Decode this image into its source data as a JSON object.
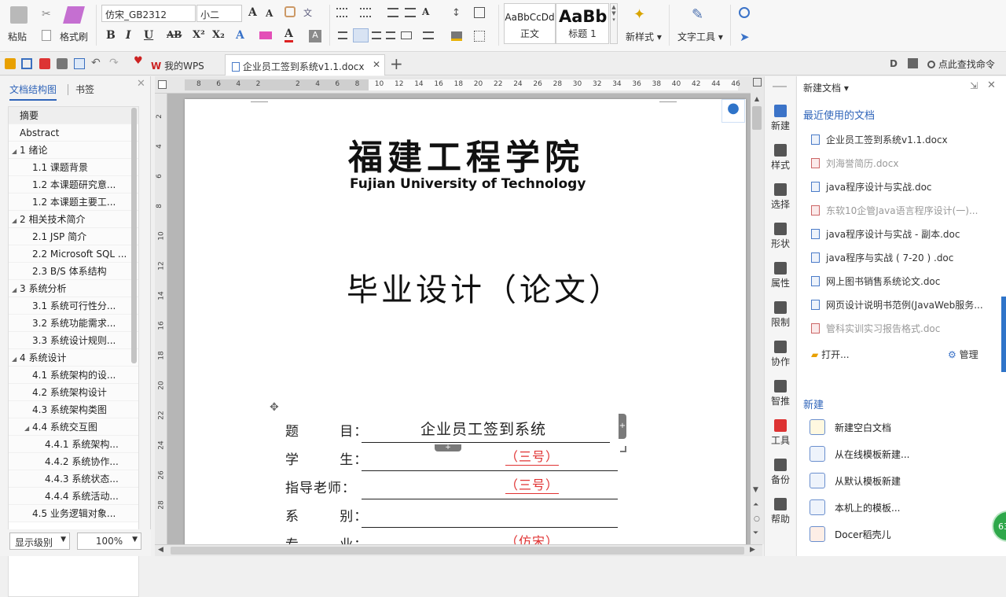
{
  "ribbon": {
    "paste": "粘贴",
    "format_painter": "格式刷",
    "font_name": "仿宋_GB2312",
    "font_size": "小二",
    "style_normal_preview": "AaBbCcDd",
    "style_normal": "正文",
    "style_h1_preview": "AaBb",
    "style_h1": "标题 1",
    "new_style": "新样式",
    "text_tools": "文字工具"
  },
  "tabs": {
    "wps": "我的WPS",
    "doc": "企业员工签到系统v1.1.docx",
    "search": "点此查找命令"
  },
  "left_panel": {
    "tab_outline": "文档结构图",
    "tab_bookmark": "书签",
    "items": [
      {
        "label": "摘要",
        "level": 1,
        "tri": ""
      },
      {
        "label": "Abstract",
        "level": 1,
        "tri": ""
      },
      {
        "label": "1  绪论",
        "level": 1,
        "tri": "◢"
      },
      {
        "label": "1.1  课题背景",
        "level": 2,
        "tri": ""
      },
      {
        "label": "1.2  本课题研究意...",
        "level": 2,
        "tri": ""
      },
      {
        "label": "1.2  本课题主要工...",
        "level": 2,
        "tri": ""
      },
      {
        "label": "2  相关技术简介",
        "level": 1,
        "tri": "◢"
      },
      {
        "label": "2.1 JSP 简介",
        "level": 2,
        "tri": ""
      },
      {
        "label": "2.2 Microsoft SQL ...",
        "level": 2,
        "tri": ""
      },
      {
        "label": "2.3 B/S 体系结构",
        "level": 2,
        "tri": ""
      },
      {
        "label": "3  系统分析",
        "level": 1,
        "tri": "◢"
      },
      {
        "label": "3.1  系统可行性分...",
        "level": 2,
        "tri": ""
      },
      {
        "label": "3.2  系统功能需求...",
        "level": 2,
        "tri": ""
      },
      {
        "label": "3.3  系统设计规则...",
        "level": 2,
        "tri": ""
      },
      {
        "label": "4  系统设计",
        "level": 1,
        "tri": "◢"
      },
      {
        "label": "4.1  系统架构的设...",
        "level": 2,
        "tri": ""
      },
      {
        "label": "4.2  系统架构设计",
        "level": 2,
        "tri": ""
      },
      {
        "label": "4.3  系统架构类图",
        "level": 2,
        "tri": ""
      },
      {
        "label": "4.4  系统交互图",
        "level": 2,
        "tri": "◢"
      },
      {
        "label": "4.4.1  系统架构...",
        "level": 3,
        "tri": ""
      },
      {
        "label": "4.4.2  系统协作...",
        "level": 3,
        "tri": ""
      },
      {
        "label": "4.4.3  系统状态...",
        "level": 3,
        "tri": ""
      },
      {
        "label": "4.4.4  系统活动...",
        "level": 3,
        "tri": ""
      },
      {
        "label": "4.5  业务逻辑对象...",
        "level": 2,
        "tri": ""
      }
    ],
    "show_level": "显示级别",
    "zoom": "100%"
  },
  "ruler": {
    "h": [
      "8",
      "6",
      "4",
      "2",
      "",
      "2",
      "4",
      "6",
      "8",
      "10",
      "12",
      "14",
      "16",
      "18",
      "20",
      "22",
      "24",
      "26",
      "28",
      "30",
      "32",
      "34",
      "36",
      "38",
      "40",
      "42",
      "44",
      "46"
    ],
    "v": [
      "2",
      "4",
      "6",
      "8",
      "10",
      "12",
      "14",
      "16",
      "18",
      "20",
      "22",
      "24",
      "26",
      "28"
    ]
  },
  "document": {
    "logo_cn": "福建工程学院",
    "logo_en": "Fujian University of Technology",
    "title": "毕业设计（论文）",
    "fields": [
      {
        "label": "题        目：",
        "value": "企业员工签到系统",
        "red": false
      },
      {
        "label": "学        生：",
        "value": "（三号）",
        "red": true
      },
      {
        "label": "指导老师：",
        "value": "（三号）",
        "red": true
      },
      {
        "label": "系        别：",
        "value": "",
        "red": false
      },
      {
        "label": "专        业：",
        "value": "（仿宋）",
        "red": true
      }
    ]
  },
  "side_tools": [
    "新建",
    "样式",
    "选择",
    "形状",
    "属性",
    "限制",
    "协作",
    "智推",
    "工具",
    "备份",
    "帮助"
  ],
  "right_panel": {
    "header": "新建文档",
    "recent_title": "最近使用的文档",
    "recent": [
      {
        "name": "企业员工签到系统v1.1.docx",
        "gray": false
      },
      {
        "name": "刘海誉简历.docx",
        "gray": true
      },
      {
        "name": "java程序设计与实战.doc",
        "gray": false
      },
      {
        "name": "东软10企管Java语言程序设计(一)...",
        "gray": true
      },
      {
        "name": "java程序设计与实战 - 副本.doc",
        "gray": false
      },
      {
        "name": "java程序与实战 ( 7-20 ) .doc",
        "gray": false
      },
      {
        "name": "网上图书销售系统论文.doc",
        "gray": false
      },
      {
        "name": "网页设计说明书范例(JavaWeb服务...",
        "gray": false
      },
      {
        "name": "管科实训实习报告格式.doc",
        "gray": true
      }
    ],
    "open": "打开...",
    "manage": "管理",
    "new_title": "新建",
    "new_items": [
      "新建空白文档",
      "从在线模板新建...",
      "从默认模板新建",
      "本机上的模板...",
      "Docer稻壳儿"
    ],
    "badge": "63"
  }
}
